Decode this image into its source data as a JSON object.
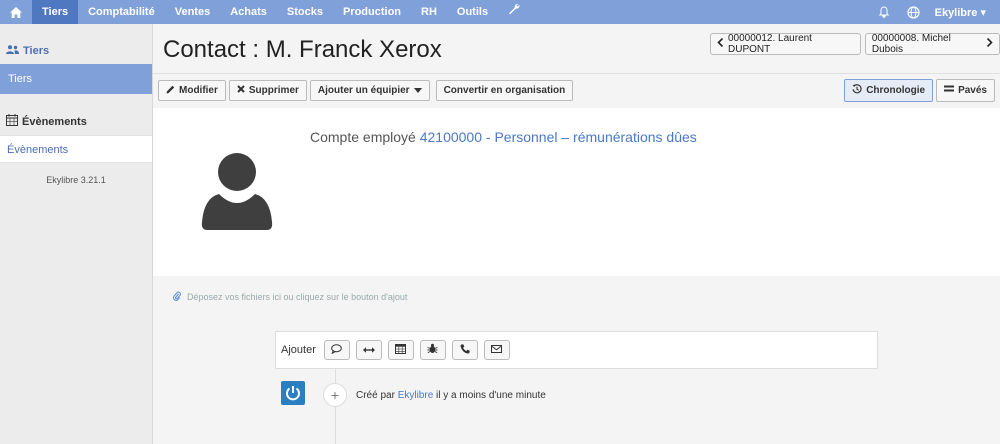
{
  "nav": {
    "items": [
      "Tiers",
      "Comptabilité",
      "Ventes",
      "Achats",
      "Stocks",
      "Production",
      "RH",
      "Outils"
    ],
    "user": "Ekylibre"
  },
  "sidebar": {
    "section1": "Tiers",
    "active_item": "Tiers",
    "section2": "Évènements",
    "link_item": "Évènements",
    "version": "Ekylibre 3.21.1"
  },
  "page": {
    "title": "Contact : M. Franck Xerox",
    "prev": "00000012. Laurent DUPONT",
    "next": "00000008. Michel Dubois"
  },
  "toolbar": {
    "edit": "Modifier",
    "delete": "Supprimer",
    "add_team": "Ajouter un équipier",
    "convert": "Convertir en organisation",
    "timeline": "Chronologie",
    "tiles": "Pavés"
  },
  "card": {
    "account_label": "Compte employé",
    "account_link": "42100000 - Personnel – rémunérations dûes"
  },
  "dropzone": "Déposez vos fichiers ici ou cliquez sur le bouton d'ajout",
  "add_box": {
    "label": "Ajouter"
  },
  "timeline": {
    "created_by": "Créé par",
    "author": "Ekylibre",
    "when": "il y a moins d'une minute"
  },
  "colors": {
    "nav": "#7fa0d8",
    "nav_active": "#4f78c0",
    "link": "#4a78c4"
  }
}
